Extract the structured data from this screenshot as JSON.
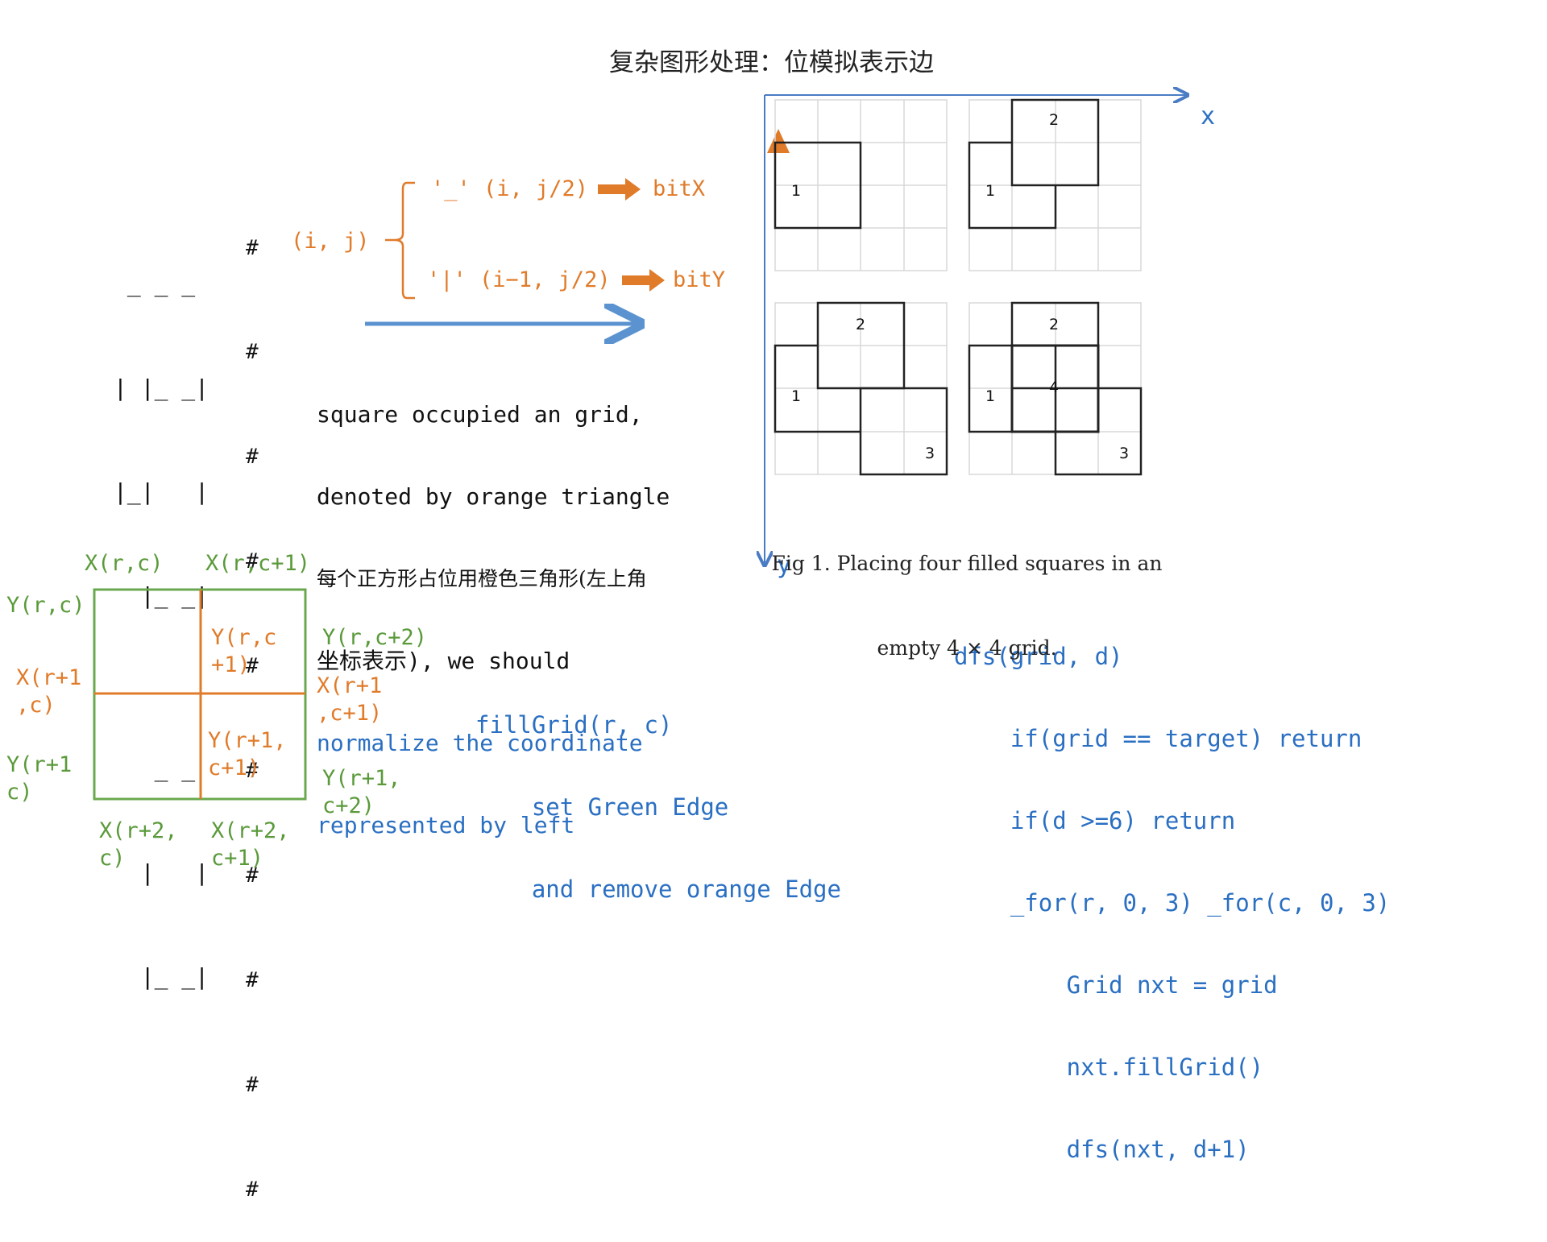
{
  "title": "复杂图形处理：位模拟表示边",
  "ascii_art": {
    "lines": [
      " _ _ _",
      "| |_ _|",
      "|_|   |",
      "  |_ _|",
      "",
      "   _ _",
      "  |   |",
      "  |_ _|"
    ],
    "hash": "#"
  },
  "mapping": {
    "source": "(i, j)",
    "underscore_rule": "'_' (i, j/2)",
    "underscore_target": "bitX",
    "pipe_rule": "'|' (i−1, j/2)",
    "pipe_target": "bitY"
  },
  "note": {
    "line1": "square occupied an grid,",
    "line2": "denoted by orange triangle",
    "line3": "每个正方形占位用橙色三角形(左上角",
    "line4": "坐标表示), we should",
    "line5": "normalize the coordinate",
    "line6": "represented by left"
  },
  "cell_diagram": {
    "top_labels": [
      "X(r,c)",
      "X(r,c+1)"
    ],
    "left_labels": [
      "Y(r,c)",
      "Y(r+1\nc)"
    ],
    "right_labels": [
      "Y(r,c+2)",
      "Y(r+1,\nc+2)"
    ],
    "bottom_labels": [
      "X(r+2,\nc)",
      "X(r+2,\nc+1)"
    ],
    "orange_labels": [
      "X(r+1\n,c)",
      "Y(r,c\n+1)",
      "X(r+1\n,c+1)",
      "Y(r+1,\nc+1)"
    ]
  },
  "fillgrid_code": [
    "fillGrid(r, c)",
    "    set Green Edge",
    "    and remove orange Edge"
  ],
  "dfs_code": [
    "dfs(grid, d)",
    "    if(grid == target) return",
    "    if(d >=6) return",
    "    _for(r, 0, 3) _for(c, 0, 3)",
    "        Grid nxt = grid",
    "        nxt.fillGrid()",
    "        dfs(nxt, d+1)"
  ],
  "figure": {
    "x_axis": "x",
    "y_axis": "y",
    "caption_line1": "Fig 1. Placing four filled squares in an",
    "caption_line2": "empty 4 × 4 grid.",
    "square_numbers": [
      "1",
      "2",
      "3",
      "4"
    ]
  },
  "colors": {
    "orange": "#e07b2a",
    "green": "#5a9a3a",
    "blue": "#2a6fc2",
    "axis_blue": "#4a7cc4",
    "arrow_blue": "#5b93d1"
  }
}
